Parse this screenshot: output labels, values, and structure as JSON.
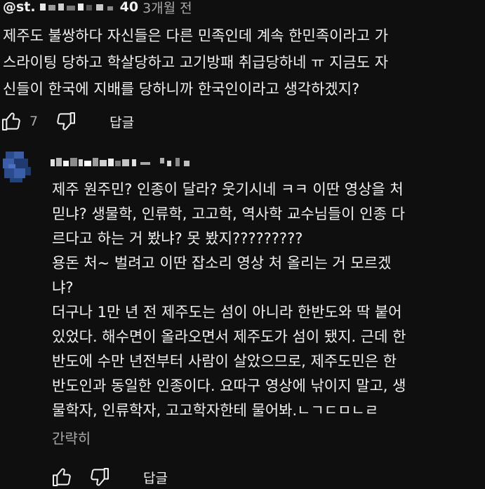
{
  "comment": {
    "author_prefix": "@st.",
    "author_suffix": "40",
    "time": "3개월 전",
    "text": "제주도 불쌍하다 자신들은 다른 민족인데 계속 한민족이라고 가\n스라이팅 당하고 학살당하고 고기방패 취급당하네 ㅠ 지금도 자\n신들이 한국에 지배를 당하니까 한국인이라고 생각하겠지?",
    "like_count": "7",
    "reply_label": "답글",
    "icons": [
      "thumbs-up-icon",
      "thumbs-down-icon"
    ]
  },
  "reply": {
    "text": "제주 원주민? 인종이 달라? 웃기시네 ㅋㅋ  이딴 영상을 처\n믿냐? 생물학, 인류학, 고고학, 역사학 교수님들이 인종 다\n르다고 하는 거 봤냐? 못 봤지?????????\n용돈 처~ 벌려고 이딴 잡소리 영상 처 올리는 거 모르겠\n냐?\n더구나 1만 년 전 제주도는 섬이 아니라 한반도와 딱 붙어\n있었다. 해수면이 올라오면서 제주도가 섬이 됐지. 근데 한\n반도에 수만 년전부터 사람이 살았으므로, 제주도민은 한\n반도인과 동일한 인종이다. 요따구 영상에 낚이지 말고, 생\n물학자, 인류학자, 고고학자한테 물어봐.ㄴㄱㄷㅁㄴㄹ",
    "collapse_label": "간략히",
    "reply_label": "답글",
    "icons": [
      "thumbs-up-icon",
      "thumbs-down-icon"
    ]
  },
  "colors": {
    "background": "#0f0f0f",
    "text": "#f1f1f1",
    "secondary_text": "#aaaaaa",
    "avatar": "#3a5fa8"
  }
}
